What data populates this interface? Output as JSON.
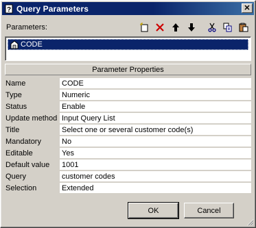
{
  "window": {
    "title": "Query Parameters",
    "close_glyph": "✕"
  },
  "parameters_label": "Parameters:",
  "toolbar": {
    "icons": [
      "new-icon",
      "delete-icon",
      "move-up-icon",
      "move-down-icon",
      "cut-icon",
      "copy-icon",
      "paste-icon"
    ],
    "accent": "#cc0000"
  },
  "list": {
    "selected_item": "CODE",
    "selected_bg": "#0a246a"
  },
  "properties": {
    "header": "Parameter Properties",
    "rows": [
      {
        "name": "Name",
        "value": "CODE"
      },
      {
        "name": "Type",
        "value": "Numeric"
      },
      {
        "name": "Status",
        "value": "Enable"
      },
      {
        "name": "Update method",
        "value": "Input Query List"
      },
      {
        "name": "Title",
        "value": "Select one or several customer code(s)"
      },
      {
        "name": "Mandatory",
        "value": "No"
      },
      {
        "name": "Editable",
        "value": "Yes"
      },
      {
        "name": "Default value",
        "value": "1001"
      },
      {
        "name": "Query",
        "value": "customer codes"
      },
      {
        "name": "Selection",
        "value": "Extended"
      }
    ]
  },
  "buttons": {
    "ok": "OK",
    "cancel": "Cancel"
  }
}
